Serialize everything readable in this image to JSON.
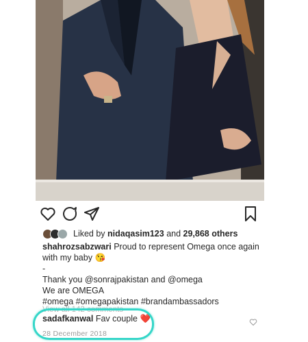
{
  "post": {
    "liked_by_prefix": "Liked by ",
    "liked_by_user": "nidaqasim123",
    "liked_by_joiner": " and ",
    "liked_by_count": "29,868 others"
  },
  "caption": {
    "username": "shahrozsabzwari",
    "line1_text": " Proud to represent Omega once again",
    "line2_text": "with my baby",
    "line2_emoji": "😘",
    "dash": "-",
    "thank_prefix": "Thank you ",
    "mention1": "@sonrajpakistan",
    "thank_joiner": " and ",
    "mention2": "@omega",
    "we_are": "We are OMEGA",
    "hashtags": "#omega #omegapakistan #brandambassadors"
  },
  "view_comments": "View all 142 comments",
  "comment": {
    "username": "sadafkanwal",
    "text": " Fav couple ",
    "emoji": "❤️",
    "date": "28 December 2018"
  },
  "colors": {
    "highlight": "#35d6c8",
    "text": "#262626",
    "muted": "#8e8e8e"
  },
  "icons": {
    "like": "heart-outline-icon",
    "comment": "speech-bubble-icon",
    "share": "paper-plane-icon",
    "save": "bookmark-icon"
  }
}
